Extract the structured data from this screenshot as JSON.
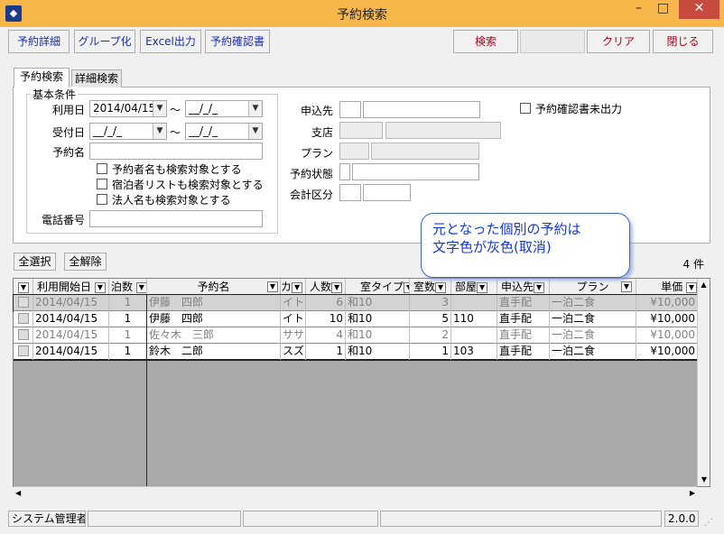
{
  "window": {
    "title": "予約検索"
  },
  "toolbar": {
    "reservation_detail": "予約詳細",
    "group": "グループ化",
    "excel": "Excel出力",
    "confirmation": "予約確認書",
    "search": "検索",
    "clear": "クリア",
    "close": "閉じる"
  },
  "tabs": {
    "basic": "予約検索",
    "detail": "詳細検索"
  },
  "basic": {
    "group_label": "基本条件",
    "use_date_label": "利用日",
    "use_date_from": "2014/04/15",
    "use_date_to": "__/_/_",
    "tilde": "〜",
    "accept_date_label": "受付日",
    "accept_date_from": "__/_/_",
    "accept_date_to": "__/_/_",
    "reservation_name_label": "予約名",
    "reservation_name_value": "",
    "chk1": "予約者名も検索対象とする",
    "chk2": "宿泊者リストも検索対象とする",
    "chk3": "法人名も検索対象とする",
    "phone_label": "電話番号",
    "phone_value": ""
  },
  "right_form": {
    "applicant_label": "申込先",
    "branch_label": "支店",
    "plan_label": "プラン",
    "status_label": "予約状態",
    "account_label": "会計区分",
    "unprinted_label": "予約確認書未出力"
  },
  "callout": {
    "line1": "元となった個別の予約は",
    "line2": "文字色が灰色(取消)"
  },
  "list_controls": {
    "select_all": "全選択",
    "deselect_all": "全解除",
    "count": "4 件"
  },
  "grid": {
    "headers": {
      "start": "利用開始日",
      "nights": "泊数",
      "name": "予約名",
      "kana": "カ",
      "people": "人数",
      "room_type": "室タイプ",
      "rooms": "室数",
      "room_no": "部屋",
      "applicant": "申込先",
      "plan": "プラン",
      "price": "単価"
    },
    "rows": [
      {
        "start": "2014/04/15",
        "nights": "1",
        "name": "伊藤　四郎",
        "kana": "イトウ",
        "people": "6",
        "room_type": "和10",
        "rooms": "3",
        "room_no": "",
        "applicant": "直手配",
        "plan": "一泊二食",
        "price": "¥10,000"
      },
      {
        "start": "2014/04/15",
        "nights": "1",
        "name": "伊藤　四郎",
        "kana": "イトウ",
        "people": "10",
        "room_type": "和10",
        "rooms": "5",
        "room_no": "110",
        "applicant": "直手配",
        "plan": "一泊二食",
        "price": "¥10,000"
      },
      {
        "start": "2014/04/15",
        "nights": "1",
        "name": "佐々木　三郎",
        "kana": "ササキ",
        "people": "4",
        "room_type": "和10",
        "rooms": "2",
        "room_no": "",
        "applicant": "直手配",
        "plan": "一泊二食",
        "price": "¥10,000"
      },
      {
        "start": "2014/04/15",
        "nights": "1",
        "name": "鈴木　二郎",
        "kana": "スズキ",
        "people": "1",
        "room_type": "和10",
        "rooms": "1",
        "room_no": "103",
        "applicant": "直手配",
        "plan": "一泊二食",
        "price": "¥10,000"
      }
    ]
  },
  "status": {
    "user": "システム管理者",
    "version": "2.0.0"
  }
}
